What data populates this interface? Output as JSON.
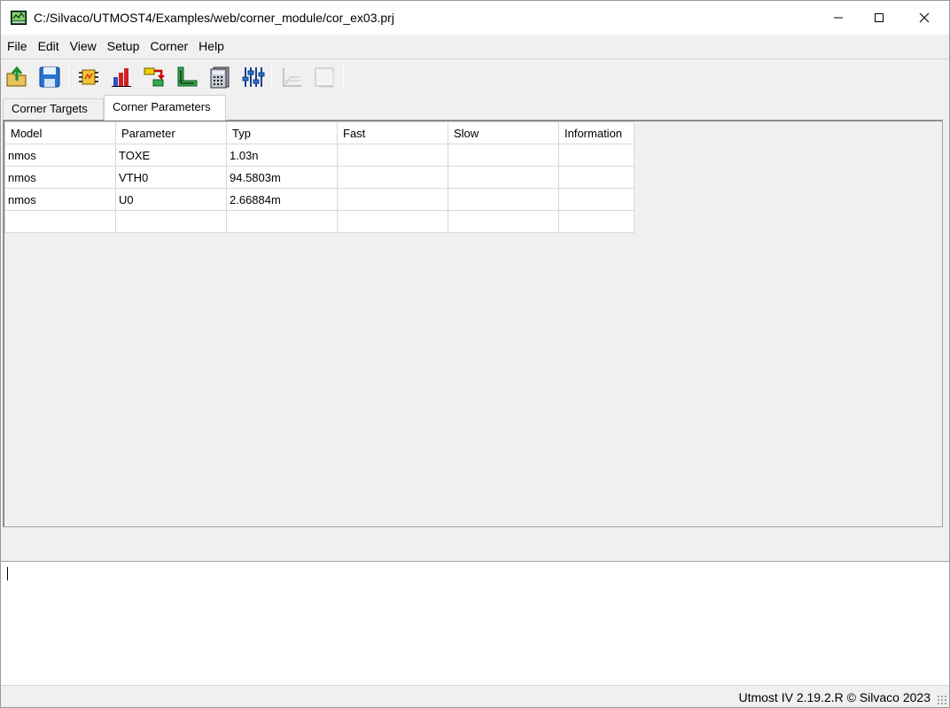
{
  "window": {
    "title": "C:/Silvaco/UTMOST4/Examples/web/corner_module/cor_ex03.prj",
    "minimize": "—",
    "maximize": "☐",
    "close": "✕"
  },
  "menu": [
    "File",
    "Edit",
    "View",
    "Setup",
    "Corner",
    "Help"
  ],
  "toolbar": {
    "buttons": [
      "open-project-icon",
      "save-icon",
      "circuit-icon",
      "bar-chart-icon",
      "flow-icon",
      "axis-plot-icon",
      "calculator-icon",
      "sliders-icon",
      "graph-icon",
      "blank-page-icon"
    ]
  },
  "tabs": [
    {
      "label": "Corner Targets",
      "active": false
    },
    {
      "label": "Corner Parameters",
      "active": true
    }
  ],
  "table": {
    "headers": [
      "Model",
      "Parameter",
      "Typ",
      "Fast",
      "Slow",
      "Information"
    ],
    "rows": [
      [
        "nmos",
        "TOXE",
        "1.03n",
        "",
        "",
        ""
      ],
      [
        "nmos",
        "VTH0",
        "94.5803m",
        "",
        "",
        ""
      ],
      [
        "nmos",
        "U0",
        "2.66884m",
        "",
        "",
        ""
      ],
      [
        "",
        "",
        "",
        "",
        "",
        ""
      ]
    ]
  },
  "status": {
    "text": "Utmost IV 2.19.2.R © Silvaco 2023"
  }
}
